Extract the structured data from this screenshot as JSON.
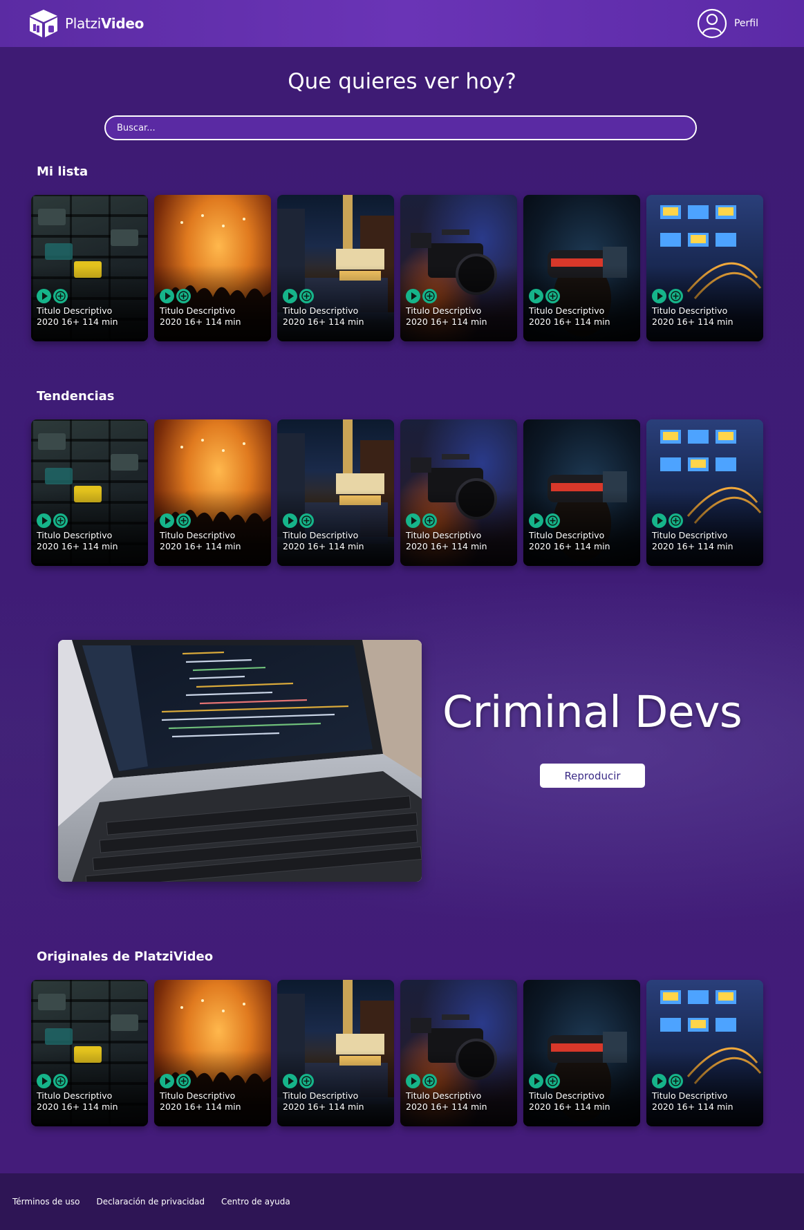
{
  "header": {
    "logo_light": "Platzi",
    "logo_bold": "Video",
    "profile_label": "Perfil"
  },
  "main": {
    "heading": "Que quieres ver hoy?",
    "search_placeholder": "Buscar..."
  },
  "sections": {
    "mi_lista": {
      "title": "Mi lista",
      "cards": [
        {
          "art": "cassette-tapes",
          "title": "Titulo Descriptivo",
          "meta": "2020 16+ 114 min"
        },
        {
          "art": "concert-crowd",
          "title": "Titulo Descriptivo",
          "meta": "2020 16+ 114 min"
        },
        {
          "art": "chicago-theatre",
          "title": "Titulo Descriptivo",
          "meta": "2020 16+ 114 min"
        },
        {
          "art": "video-camera",
          "title": "Titulo Descriptivo",
          "meta": "2020 16+ 114 min"
        },
        {
          "art": "vr-headset",
          "title": "Titulo Descriptivo",
          "meta": "2020 16+ 114 min"
        },
        {
          "art": "server-rack",
          "title": "Titulo Descriptivo",
          "meta": "2020 16+ 114 min"
        }
      ]
    },
    "tendencias": {
      "title": "Tendencias",
      "cards": [
        {
          "art": "cassette-tapes",
          "title": "Titulo Descriptivo",
          "meta": "2020 16+ 114 min"
        },
        {
          "art": "concert-crowd",
          "title": "Titulo Descriptivo",
          "meta": "2020 16+ 114 min"
        },
        {
          "art": "chicago-theatre",
          "title": "Titulo Descriptivo",
          "meta": "2020 16+ 114 min"
        },
        {
          "art": "video-camera",
          "title": "Titulo Descriptivo",
          "meta": "2020 16+ 114 min"
        },
        {
          "art": "vr-headset",
          "title": "Titulo Descriptivo",
          "meta": "2020 16+ 114 min"
        },
        {
          "art": "server-rack",
          "title": "Titulo Descriptivo",
          "meta": "2020 16+ 114 min"
        }
      ]
    },
    "originales": {
      "title": "Originales de PlatziVideo",
      "cards": [
        {
          "art": "cassette-tapes",
          "title": "Titulo Descriptivo",
          "meta": "2020 16+ 114 min"
        },
        {
          "art": "concert-crowd",
          "title": "Titulo Descriptivo",
          "meta": "2020 16+ 114 min"
        },
        {
          "art": "chicago-theatre",
          "title": "Titulo Descriptivo",
          "meta": "2020 16+ 114 min"
        },
        {
          "art": "video-camera",
          "title": "Titulo Descriptivo",
          "meta": "2020 16+ 114 min"
        },
        {
          "art": "vr-headset",
          "title": "Titulo Descriptivo",
          "meta": "2020 16+ 114 min"
        },
        {
          "art": "server-rack",
          "title": "Titulo Descriptivo",
          "meta": "2020 16+ 114 min"
        }
      ]
    }
  },
  "featured": {
    "title": "Criminal Devs",
    "button_label": "Reproducir",
    "image": "laptop-code"
  },
  "footer": {
    "links": [
      "Términos de uso",
      "Declaración de privacidad",
      "Centro de ayuda"
    ]
  },
  "colors": {
    "header_bg": "#6a34b6",
    "page_bg": "#3e1b74",
    "accent_green": "#16b48a",
    "footer_bg": "#2e1555"
  },
  "icons": [
    "platzivideo-logo-icon",
    "user-profile-icon",
    "play-icon",
    "add-icon"
  ]
}
